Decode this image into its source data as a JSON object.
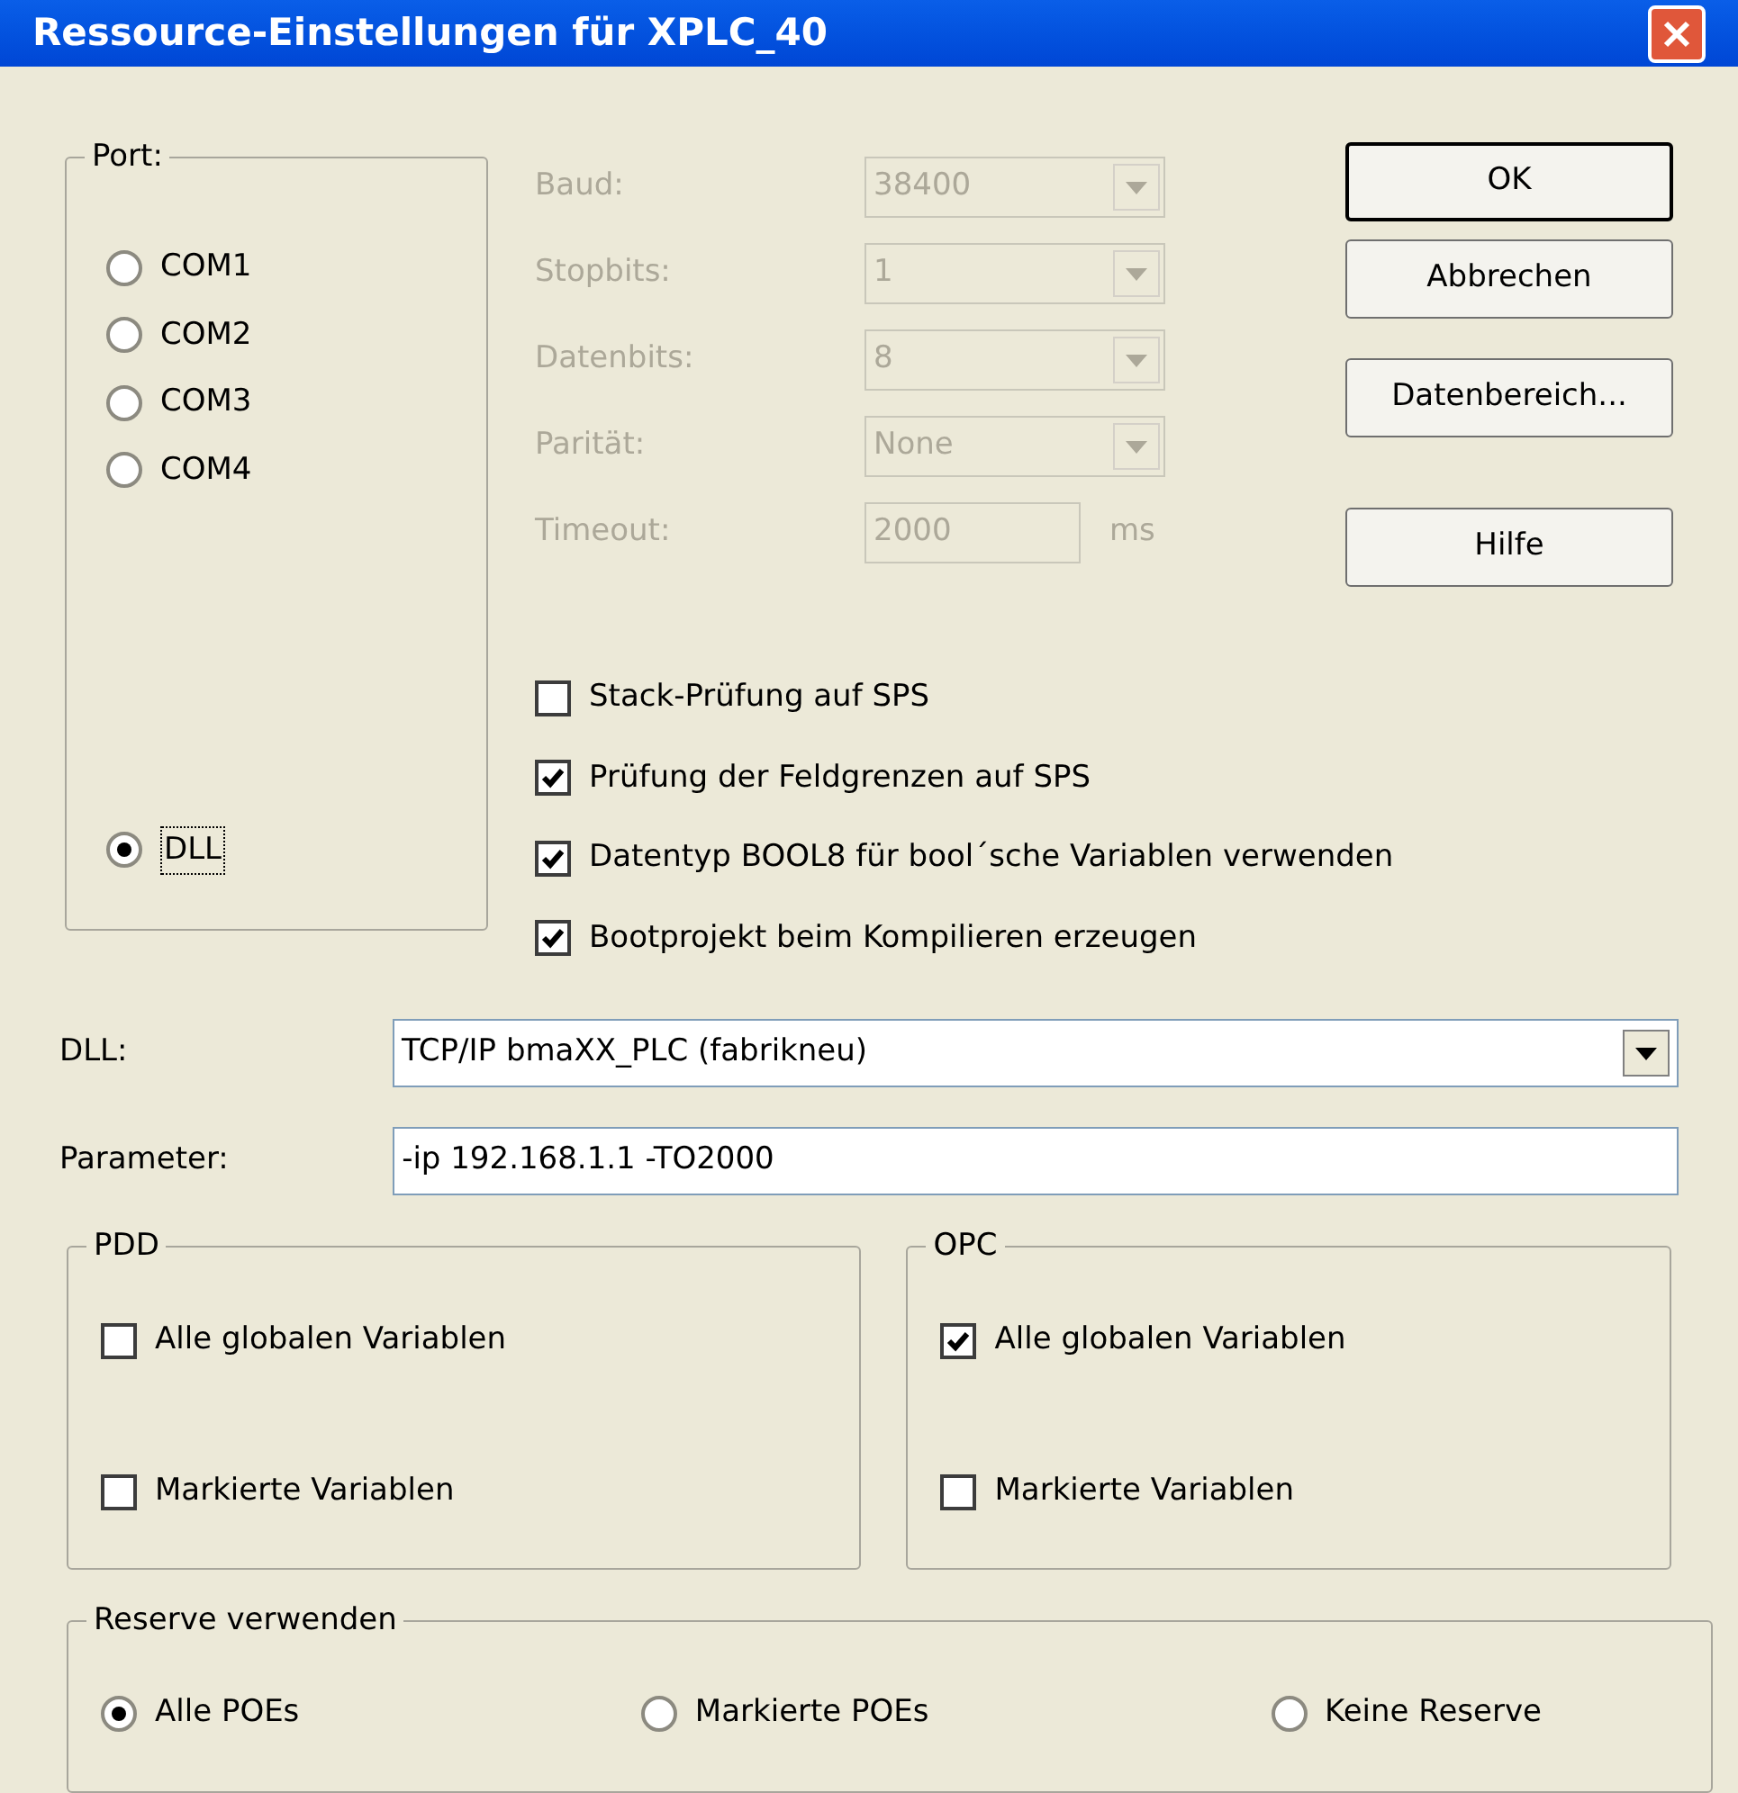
{
  "window": {
    "title": "Ressource-Einstellungen für XPLC_40"
  },
  "port": {
    "title": "Port:",
    "options": [
      {
        "label": "COM1",
        "selected": false
      },
      {
        "label": "COM2",
        "selected": false
      },
      {
        "label": "COM3",
        "selected": false
      },
      {
        "label": "COM4",
        "selected": false
      }
    ],
    "dll_option": {
      "label": "DLL",
      "selected": true
    }
  },
  "settings": [
    {
      "kind": "combo",
      "label": "Baud:",
      "value": "38400",
      "disabled": true
    },
    {
      "kind": "combo",
      "label": "Stopbits:",
      "value": "1",
      "disabled": true
    },
    {
      "kind": "combo",
      "label": "Datenbits:",
      "value": "8",
      "disabled": true
    },
    {
      "kind": "combo",
      "label": "Parität:",
      "value": "None",
      "disabled": true
    },
    {
      "kind": "input",
      "label": "Timeout:",
      "value": "2000",
      "unit": "ms",
      "disabled": true
    }
  ],
  "buttons": [
    {
      "label": "OK",
      "default": true
    },
    {
      "label": "Abbrechen",
      "default": false
    },
    {
      "label": "Datenbereich...",
      "default": false
    },
    {
      "label": "Hilfe",
      "default": false
    }
  ],
  "checks": [
    {
      "label": "Stack-Prüfung auf SPS",
      "checked": false
    },
    {
      "label": "Prüfung der Feldgrenzen auf SPS",
      "checked": true
    },
    {
      "label": "Datentyp BOOL8 für bool´sche Variablen verwenden",
      "checked": true
    },
    {
      "label": "Bootprojekt beim Kompilieren erzeugen",
      "checked": true
    }
  ],
  "dll": {
    "label": "DLL:",
    "value": "TCP/IP bmaXX_PLC (fabrikneu)"
  },
  "parameter": {
    "label": "Parameter:",
    "value": "-ip 192.168.1.1 -TO2000"
  },
  "pdd": {
    "title": "PDD",
    "options": [
      {
        "label": "Alle globalen Variablen",
        "checked": false
      },
      {
        "label": "Markierte Variablen",
        "checked": false
      }
    ]
  },
  "opc": {
    "title": "OPC",
    "options": [
      {
        "label": "Alle globalen Variablen",
        "checked": true
      },
      {
        "label": "Markierte Variablen",
        "checked": false
      }
    ]
  },
  "reserve": {
    "title": "Reserve verwenden",
    "options": [
      {
        "label": "Alle POEs",
        "selected": true
      },
      {
        "label": "Markierte POEs",
        "selected": false
      },
      {
        "label": "Keine Reserve",
        "selected": false
      }
    ]
  }
}
